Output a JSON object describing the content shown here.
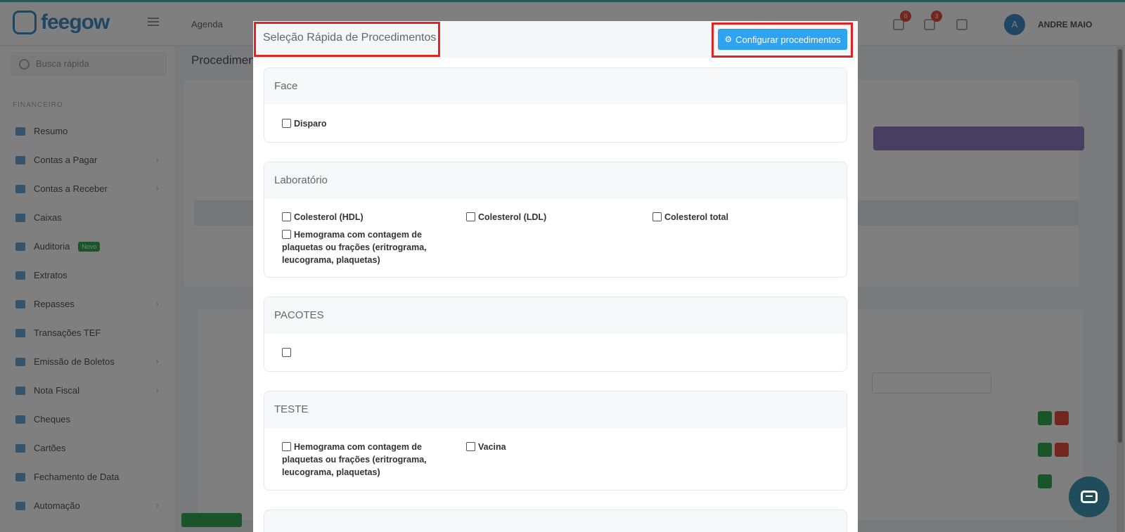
{
  "app": {
    "brand": "feegow",
    "agenda_label": "Agenda",
    "user_initial": "A",
    "user_name": "ANDRE MAIO",
    "notif_counts": [
      "0",
      "3"
    ],
    "search_placeholder": "Busca rápida",
    "section_label": "FINANCEIRO",
    "content_title": "Procedimentos"
  },
  "sidebar": {
    "items": [
      {
        "label": "Resumo",
        "chevron": false
      },
      {
        "label": "Contas a Pagar",
        "chevron": true
      },
      {
        "label": "Contas a Receber",
        "chevron": true
      },
      {
        "label": "Caixas",
        "chevron": false
      },
      {
        "label": "Auditoria",
        "chevron": false,
        "badge": "Novo"
      },
      {
        "label": "Extratos",
        "chevron": false
      },
      {
        "label": "Repasses",
        "chevron": true
      },
      {
        "label": "Transações TEF",
        "chevron": false
      },
      {
        "label": "Emissão de Boletos",
        "chevron": true
      },
      {
        "label": "Nota Fiscal",
        "chevron": true
      },
      {
        "label": "Cheques",
        "chevron": false
      },
      {
        "label": "Cartões",
        "chevron": false
      },
      {
        "label": "Fechamento de Data",
        "chevron": false
      },
      {
        "label": "Automação",
        "chevron": true
      }
    ]
  },
  "modal": {
    "title": "Seleção Rápida de Procedimentos",
    "configure_button": "Configurar procedimentos",
    "gear_icon": "gear-icon",
    "groups": [
      {
        "name": "Face",
        "items": [
          "Disparo"
        ]
      },
      {
        "name": "Laboratório",
        "items": [
          "Colesterol (HDL)",
          "Colesterol (LDL)",
          "Colesterol total",
          "Hemograma com contagem de plaquetas ou frações (eritrograma, leucograma, plaquetas)"
        ]
      },
      {
        "name": "PACOTES",
        "items": [
          ""
        ]
      },
      {
        "name": "TESTE",
        "items": [
          "Hemograma com contagem de plaquetas ou frações (eritrograma, leucograma, plaquetas)",
          "Vacina"
        ]
      }
    ]
  },
  "colors": {
    "primary": "#2ea3f2",
    "highlight": "#e02424",
    "chat": "#1f4d5b"
  }
}
